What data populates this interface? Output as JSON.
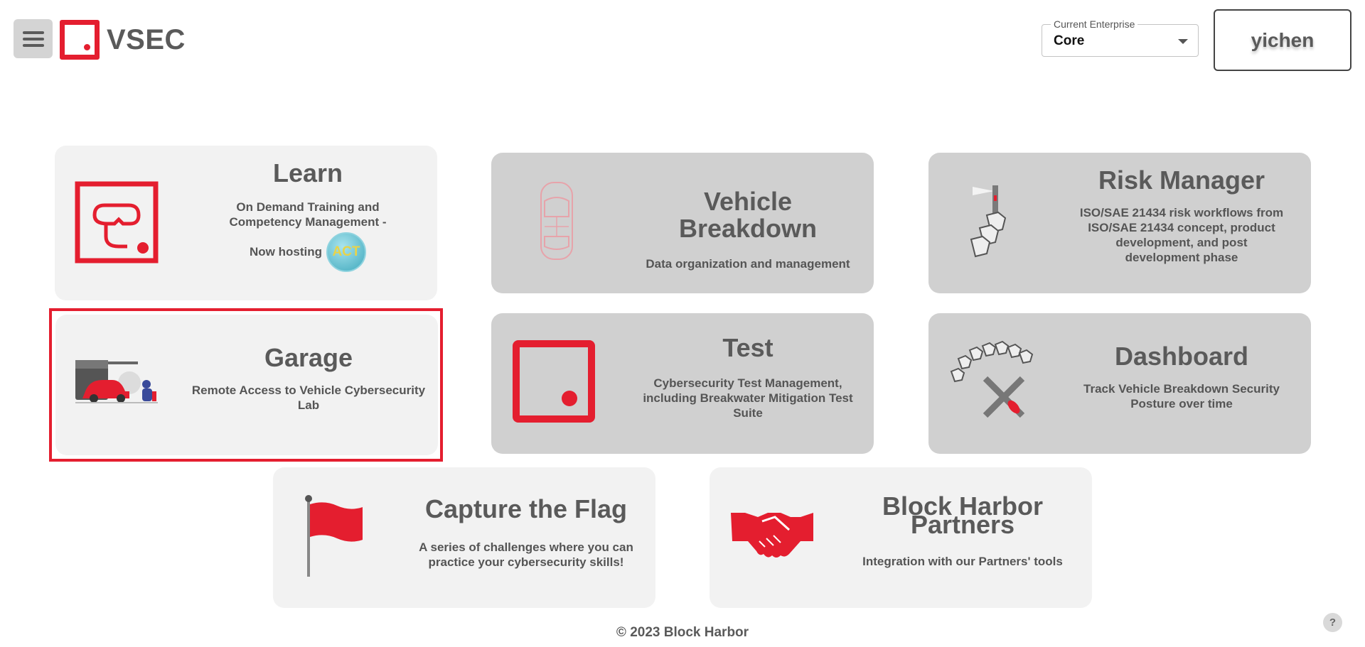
{
  "header": {
    "brand": "VSEC",
    "enterprise_label": "Current Enterprise",
    "enterprise_value": "Core",
    "user_name": "yichen"
  },
  "cards": {
    "learn": {
      "title": "Learn",
      "desc": "On Demand Training and Competency Management -",
      "hosting": "Now hosting",
      "badge": "ACT"
    },
    "vehicle": {
      "title": "Vehicle Breakdown",
      "desc": "Data organization and management"
    },
    "risk": {
      "title": "Risk Manager",
      "desc": "ISO/SAE 21434 risk workflows from ISO/SAE 21434 concept, product development, and post development phase"
    },
    "garage": {
      "title": "Garage",
      "desc": "Remote Access to Vehicle Cybersecurity Lab"
    },
    "test": {
      "title": "Test",
      "desc": "Cybersecurity Test Management, including Breakwater Mitigation Test Suite"
    },
    "dashboard": {
      "title": "Dashboard",
      "desc": "Track Vehicle Breakdown Security Posture over time"
    },
    "ctf": {
      "title": "Capture the Flag",
      "desc": "A series of challenges where you can practice your cybersecurity skills!"
    },
    "partners": {
      "title": "Block Harbor Partners",
      "desc": "Integration with our Partners' tools"
    }
  },
  "footer": {
    "copyright": "© 2023 Block Harbor"
  },
  "help": {
    "label": "?"
  },
  "colors": {
    "accent": "#e41e2f",
    "card_light": "#f2f2f2",
    "card_dark": "#d0d0d0",
    "text": "#5a5a5a"
  }
}
